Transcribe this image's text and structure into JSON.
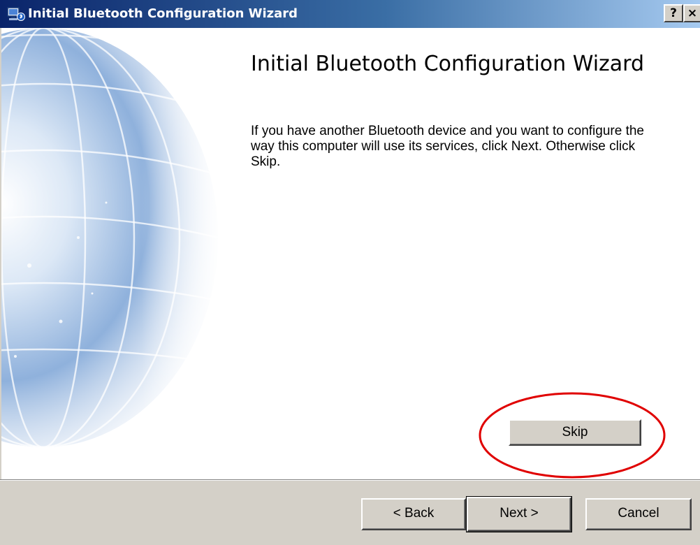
{
  "window": {
    "title": "Initial Bluetooth Configuration Wizard",
    "help_button": "?",
    "close_button": "×"
  },
  "wizard": {
    "heading": "Initial Bluetooth Configuration Wizard",
    "description": "If you have another Bluetooth device and you want to configure the way this computer will use its services, click Next. Otherwise click Skip.",
    "skip_label": "Skip"
  },
  "footer": {
    "back_label": "< Back",
    "next_label": "Next >",
    "cancel_label": "Cancel"
  },
  "colors": {
    "title_bar": "#0a246a",
    "dialog_face": "#d4d0c8",
    "highlight": "#e00000"
  },
  "icons": {
    "title": "bluetooth-computer-icon",
    "sidebar_art": "globe-graphic"
  }
}
